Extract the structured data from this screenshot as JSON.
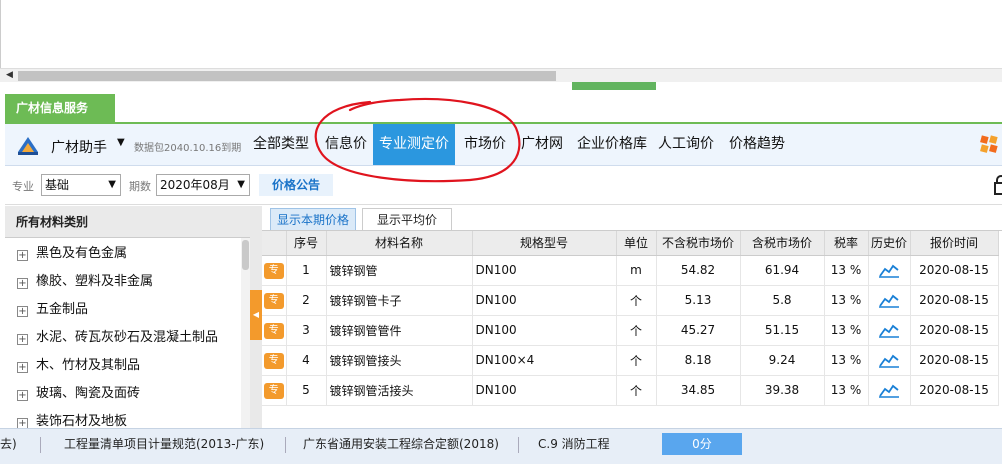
{
  "panel_tab": "广材信息服务",
  "nav": {
    "brand": "广材助手",
    "package": "数据包2040.10.16到期",
    "items": [
      {
        "label": "全部类型",
        "active": false
      },
      {
        "label": "信息价",
        "active": false
      },
      {
        "label": "专业测定价",
        "active": true
      },
      {
        "label": "市场价",
        "active": false
      },
      {
        "label": "广材网",
        "active": false
      },
      {
        "label": "企业价格库",
        "active": false
      },
      {
        "label": "人工询价",
        "active": false
      },
      {
        "label": "价格趋势",
        "active": false
      }
    ]
  },
  "filter": {
    "specialty_label": "专业",
    "specialty_value": "基础",
    "period_label": "期数",
    "period_value": "2020年08月",
    "notice": "价格公告"
  },
  "categories": {
    "header": "所有材料类别",
    "items": [
      "黑色及有色金属",
      "橡胶、塑料及非金属",
      "五金制品",
      "水泥、砖瓦灰砂石及混凝土制品",
      "木、竹材及其制品",
      "玻璃、陶瓷及面砖",
      "装饰石材及地板"
    ]
  },
  "sub_tabs": [
    "显示本期价格",
    "显示平均价"
  ],
  "table": {
    "headers": [
      "序号",
      "材料名称",
      "规格型号",
      "单位",
      "不含税市场价",
      "含税市场价",
      "税率",
      "历史价",
      "报价时间"
    ],
    "tag": "专",
    "rows": [
      {
        "no": "1",
        "name": "镀锌钢管",
        "spec": "DN100",
        "unit": "m",
        "price_ex": "54.82",
        "price_in": "61.94",
        "tax": "13 %",
        "date": "2020-08-15"
      },
      {
        "no": "2",
        "name": "镀锌钢管卡子",
        "spec": "DN100",
        "unit": "个",
        "price_ex": "5.13",
        "price_in": "5.8",
        "tax": "13 %",
        "date": "2020-08-15"
      },
      {
        "no": "3",
        "name": "镀锌钢管管件",
        "spec": "DN100",
        "unit": "个",
        "price_ex": "45.27",
        "price_in": "51.15",
        "tax": "13 %",
        "date": "2020-08-15"
      },
      {
        "no": "4",
        "name": "镀锌钢管接头",
        "spec": "DN100×4",
        "unit": "个",
        "price_ex": "8.18",
        "price_in": "9.24",
        "tax": "13 %",
        "date": "2020-08-15"
      },
      {
        "no": "5",
        "name": "镀锌钢管活接头",
        "spec": "DN100",
        "unit": "个",
        "price_ex": "34.85",
        "price_in": "39.38",
        "tax": "13 %",
        "date": "2020-08-15"
      }
    ]
  },
  "status_bar": {
    "items": [
      "去)",
      "工程量清单项目计量规范(2013-广东)",
      "广东省通用安装工程综合定额(2018)",
      "C.9 消防工程"
    ],
    "score": "0分"
  },
  "colors": {
    "accent": "#2b97df",
    "green": "#6dbb55",
    "orange": "#f39a2c",
    "annotation": "#e0141e"
  }
}
